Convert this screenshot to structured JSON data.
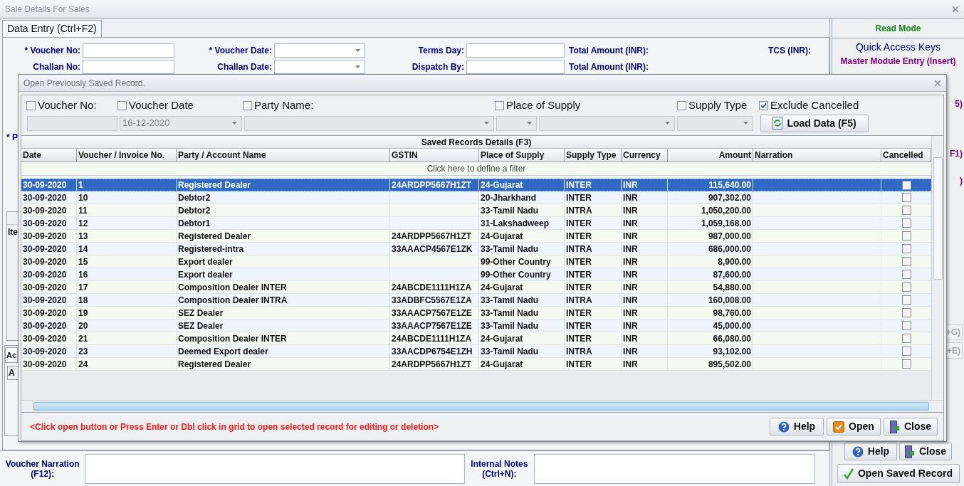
{
  "window": {
    "title": "Sale Details For Sales"
  },
  "tab": {
    "label": "Data Entry (Ctrl+F2)",
    "selected": true
  },
  "entry_rows": [
    {
      "fields": [
        {
          "label": "* Voucher No:",
          "kind": "text"
        },
        {
          "label": "* Voucher Date:",
          "kind": "date"
        },
        {
          "label": "Terms Day:",
          "kind": "text"
        }
      ],
      "totals": [
        "Total Amount (INR):",
        "TCS (INR):"
      ]
    },
    {
      "fields": [
        {
          "label": "Challan No:",
          "kind": "text"
        },
        {
          "label": "Challan Date:",
          "kind": "date"
        },
        {
          "label": "Dispatch By:",
          "kind": "text"
        }
      ],
      "totals": [
        "Total Amount (INR):"
      ]
    }
  ],
  "partial_labels": {
    "party": "* P",
    "item_header": "Ite",
    "tab": "Ac",
    "grid_header": "A"
  },
  "side_panel": {
    "mode": "Read Mode",
    "quick_keys_title": "Quick Access Keys",
    "quick_keys": [
      "Master Module Entry (Insert)"
    ],
    "partial_keys": [
      "5)",
      "F1)",
      ")"
    ],
    "partial_buttons": [
      "+G)",
      "+E)"
    ],
    "buttons": [
      "Help",
      "Close"
    ],
    "open_button": "Open Saved Record"
  },
  "narration": {
    "label": "Voucher Narration (F12):",
    "notes_label": "Internal Notes (Ctrl+N):"
  },
  "dialog": {
    "title": "Open Previously Saved Record.",
    "filters": [
      {
        "label": "Voucher No:",
        "checked": false
      },
      {
        "label": "Voucher Date",
        "checked": false
      },
      {
        "label": "Party Name:",
        "checked": false
      },
      {
        "label": "Place of Supply",
        "checked": false
      },
      {
        "label": "Supply Type",
        "checked": false
      },
      {
        "label": "Exclude Cancelled",
        "checked": true
      }
    ],
    "inputs": [
      {
        "kind": "text"
      },
      {
        "kind": "dropdown",
        "value": "16-12-2020"
      },
      {
        "kind": "dropdown"
      },
      {
        "kind": "dropdown"
      },
      {
        "kind": "dropdown"
      },
      {
        "kind": "dropdown"
      }
    ],
    "load_button": "Load Data (F5)",
    "grid_title": "Saved Records Details (F3)",
    "columns": [
      "Date",
      "Voucher / Invoice No.",
      "Party / Account Name",
      "GSTIN",
      "Place of Supply",
      "Supply Type",
      "Currency",
      "Amount",
      "Narration",
      "Cancelled"
    ],
    "filter_hint": "Click here to define a filter",
    "rows": [
      {
        "date": "30-09-2020",
        "voucher": "1",
        "party": "Registered Dealer",
        "gstin": "24ARDPP5667H1ZT",
        "place": "24-Gujarat",
        "supply_type": "INTER",
        "currency": "INR",
        "amount": "115,640.00",
        "cancelled": false,
        "selected": true
      },
      {
        "date": "30-09-2020",
        "voucher": "10",
        "party": "Debtor2",
        "place": "20-Jharkhand",
        "supply_type": "INTER",
        "currency": "INR",
        "amount": "907,302.00",
        "cancelled": false,
        "selected": false
      },
      {
        "date": "30-09-2020",
        "voucher": "11",
        "party": "Debtor2",
        "place": "33-Tamil Nadu",
        "supply_type": "INTRA",
        "currency": "INR",
        "amount": "1,050,200.00",
        "cancelled": false,
        "selected": false
      },
      {
        "date": "30-09-2020",
        "voucher": "12",
        "party": "Debtor1",
        "place": "31-Lakshadweep",
        "supply_type": "INTER",
        "currency": "INR",
        "amount": "1,059,168.00",
        "cancelled": false,
        "selected": false
      },
      {
        "date": "30-09-2020",
        "voucher": "13",
        "party": "Registered Dealer",
        "gstin": "24ARDPP5667H1ZT",
        "place": "24-Gujarat",
        "supply_type": "INTER",
        "currency": "INR",
        "amount": "987,000.00",
        "cancelled": false,
        "selected": false
      },
      {
        "date": "30-09-2020",
        "voucher": "14",
        "party": "Registered-intra",
        "gstin": "33AAACP4567E1ZK",
        "place": "33-Tamil Nadu",
        "supply_type": "INTRA",
        "currency": "INR",
        "amount": "686,000.00",
        "cancelled": false,
        "selected": false
      },
      {
        "date": "30-09-2020",
        "voucher": "15",
        "party": "Export dealer",
        "place": "99-Other Country",
        "supply_type": "INTER",
        "currency": "INR",
        "amount": "8,900.00",
        "cancelled": false,
        "selected": false
      },
      {
        "date": "30-09-2020",
        "voucher": "16",
        "party": "Export dealer",
        "place": "99-Other Country",
        "supply_type": "INTER",
        "currency": "INR",
        "amount": "87,600.00",
        "cancelled": false,
        "selected": false
      },
      {
        "date": "30-09-2020",
        "voucher": "17",
        "party": "Composition Dealer INTER",
        "gstin": "24ABCDE1111H1ZA",
        "place": "24-Gujarat",
        "supply_type": "INTER",
        "currency": "INR",
        "amount": "54,880.00",
        "cancelled": false,
        "selected": false
      },
      {
        "date": "30-09-2020",
        "voucher": "18",
        "party": "Composition Dealer INTRA",
        "gstin": "33ADBFC5567E1ZA",
        "place": "33-Tamil Nadu",
        "supply_type": "INTRA",
        "currency": "INR",
        "amount": "160,008.00",
        "cancelled": false,
        "selected": false
      },
      {
        "date": "30-09-2020",
        "voucher": "19",
        "party": "SEZ Dealer",
        "gstin": "33AAACP7567E1ZE",
        "place": "33-Tamil Nadu",
        "supply_type": "INTER",
        "currency": "INR",
        "amount": "98,760.00",
        "cancelled": false,
        "selected": false
      },
      {
        "date": "30-09-2020",
        "voucher": "20",
        "party": "SEZ Dealer",
        "gstin": "33AAACP7567E1ZE",
        "place": "33-Tamil Nadu",
        "supply_type": "INTER",
        "currency": "INR",
        "amount": "45,000.00",
        "cancelled": false,
        "selected": false
      },
      {
        "date": "30-09-2020",
        "voucher": "21",
        "party": "Composition Dealer INTER",
        "gstin": "24ABCDE1111H1ZA",
        "place": "24-Gujarat",
        "supply_type": "INTER",
        "currency": "INR",
        "amount": "66,080.00",
        "cancelled": false,
        "selected": false
      },
      {
        "date": "30-09-2020",
        "voucher": "23",
        "party": "Deemed Export dealer",
        "gstin": "33AACDP6754E1ZH",
        "place": "33-Tamil Nadu",
        "supply_type": "INTRA",
        "currency": "INR",
        "amount": "93,102.00",
        "cancelled": false,
        "selected": false
      },
      {
        "date": "30-09-2020",
        "voucher": "24",
        "party": "Registered Dealer",
        "gstin": "24ARDPP5667H1ZT",
        "place": "24-Gujarat",
        "supply_type": "INTER",
        "currency": "INR",
        "amount": "895,502.00",
        "cancelled": false,
        "selected": false
      }
    ],
    "message": "<Click open button or Press Enter or Dbl click in grid to open selected record for editing or deletion>",
    "buttons": [
      "Help",
      "Open",
      "Close"
    ]
  }
}
